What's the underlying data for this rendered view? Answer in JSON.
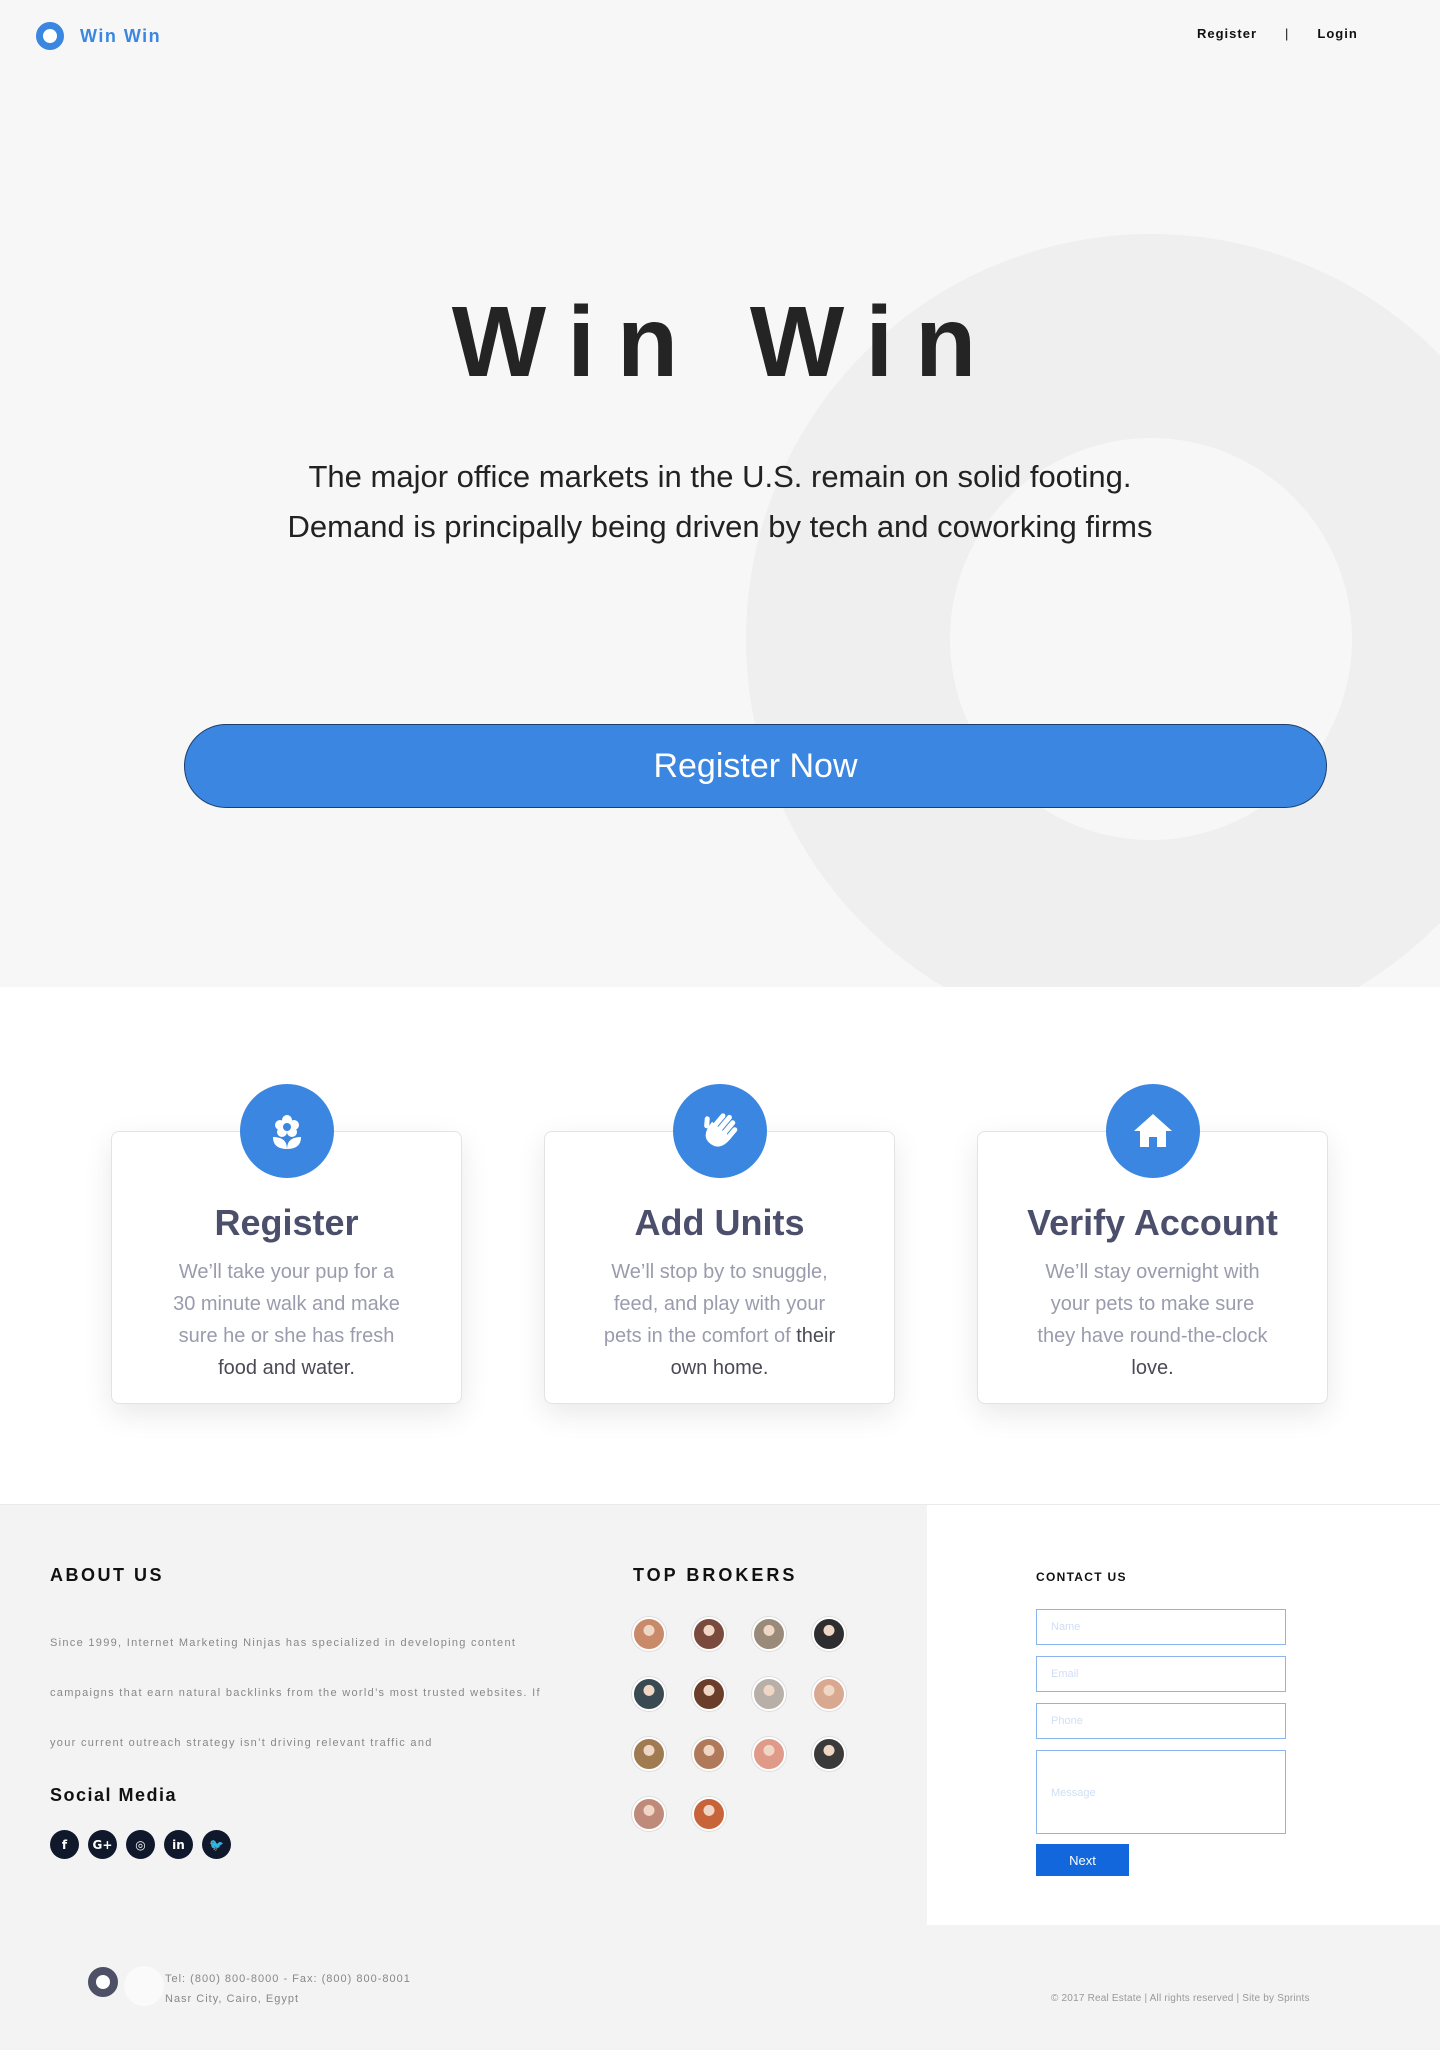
{
  "nav": {
    "brand": "Win Win",
    "register": "Register",
    "separator": "|",
    "login": "Login"
  },
  "hero": {
    "title": "Win Win",
    "subtitle_line1": "The major office markets in the U.S. remain on solid footing.",
    "subtitle_line2": "Demand is principally being driven by tech and coworking firms",
    "cta": "Register Now"
  },
  "features": [
    {
      "icon": "flower-icon",
      "title": "Register",
      "text": "We’ll take your pup for a 30 minute walk and make sure he or she has fresh",
      "text_dark": "food and water."
    },
    {
      "icon": "waving-hand-icon",
      "title": "Add Units",
      "text": "We’ll stop by to snuggle, feed, and play with your pets in the comfort of",
      "text_dark": "their own home."
    },
    {
      "icon": "home-icon",
      "title": "Verify Account",
      "text": "We’ll stay overnight with your pets to make sure they have round-the-clock",
      "text_dark": "love."
    }
  ],
  "about": {
    "heading": "ABOUT US",
    "body": "Since 1999, Internet Marketing Ninjas has specialized in developing content campaigns that earn natural backlinks from the world’s most trusted websites. If your current outreach strategy isn’t driving relevant traffic and"
  },
  "social": {
    "heading": "Social Media",
    "icons": [
      {
        "name": "facebook-icon",
        "glyph": "f"
      },
      {
        "name": "google-plus-icon",
        "glyph": "G+"
      },
      {
        "name": "instagram-icon",
        "glyph": "◎"
      },
      {
        "name": "linkedin-icon",
        "glyph": "in"
      },
      {
        "name": "twitter-icon",
        "glyph": "🐦"
      }
    ]
  },
  "brokers": {
    "heading": "TOP BROKERS",
    "avatar_colors": [
      "#c98a6a",
      "#7a4a3e",
      "#9a8a7a",
      "#2e2e30",
      "#3a4a52",
      "#6a3e2a",
      "#b8b0a8",
      "#d8a890",
      "#a07a50",
      "#b07a5a",
      "#e09a8a",
      "#3a3a3a",
      "#c08a7a",
      "#c8643a"
    ]
  },
  "contact": {
    "heading": "CONTACT US",
    "name_placeholder": "Name",
    "email_placeholder": "Email",
    "phone_placeholder": "Phone",
    "message_placeholder": "Message",
    "next": "Next"
  },
  "footer": {
    "tel": "Tel: (800) 800-8000 - Fax: (800) 800-8001",
    "address": "Nasr City, Cairo, Egypt",
    "copyright": "© 2017 Real Estate | All rights reserved | Site by Sprints"
  },
  "colors": {
    "accent": "#3a86e0",
    "button": "#1267dc",
    "heading": "#4c4f6b",
    "social_bg": "#10182b"
  }
}
